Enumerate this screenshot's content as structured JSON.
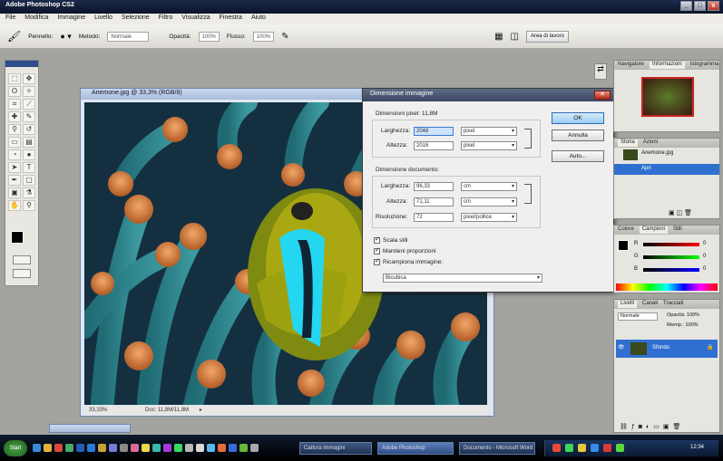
{
  "app": {
    "title": "Adobe Photoshop CS2",
    "window_buttons": [
      "_",
      "□",
      "x"
    ]
  },
  "menubar": {
    "items": [
      "File",
      "Modifica",
      "Immagine",
      "Livello",
      "Selezione",
      "Filtro",
      "Visualizza",
      "Finestra",
      "Aiuto"
    ]
  },
  "options_bar": {
    "tool_icon": "brush-icon",
    "brush_label": "Pennello:",
    "mode_label": "Metodo:",
    "mode_value": "Normale",
    "opacity_label": "Opacità:",
    "opacity_value": "100%",
    "flow_label": "Flusso:",
    "flow_value": "100%",
    "workspace_button": "Area di lavoro"
  },
  "document": {
    "title": "Anemone.jpg @ 33,3% (RGB/8)",
    "zoom": "33,33%",
    "status": "Doc: 11,8M/11,8M"
  },
  "dialog": {
    "title": "Dimensione immagine",
    "pixel_dims_label": "Dimensioni pixel: 11,8M",
    "width_label": "Larghezza:",
    "width_value": "2048",
    "width_unit": "pixel",
    "height_label": "Altezza:",
    "height_value": "2016",
    "height_unit": "pixel",
    "doc_size_label": "Dimensione documento:",
    "doc_width_label": "Larghezza:",
    "doc_width_value": "96,33",
    "doc_width_unit": "cm",
    "doc_height_label": "Altezza:",
    "doc_height_value": "71,11",
    "doc_height_unit": "cm",
    "resolution_label": "Risoluzione:",
    "resolution_value": "72",
    "resolution_unit": "pixel/pollice",
    "scale_styles": "Scala stili",
    "constrain": "Mantieni proporzioni",
    "resample": "Ricampiona immagine:",
    "resample_method": "Bicubica",
    "ok": "OK",
    "cancel": "Annulla",
    "auto": "Auto..."
  },
  "panels": {
    "navigator_tabs": [
      "Navigatore",
      "Informazioni",
      "Istogramma"
    ],
    "history_tabs": [
      "Storia",
      "Azioni"
    ],
    "history_items": [
      "Anemone.jpg",
      "Apri"
    ],
    "color_tabs": [
      "Colore",
      "Campioni",
      "Stili"
    ],
    "color_channels": [
      "R",
      "G",
      "B"
    ],
    "color_values": [
      "0",
      "0",
      "0"
    ],
    "layers_tabs": [
      "Livelli",
      "Canali",
      "Tracciati"
    ],
    "layer_mode": "Normale",
    "layer_opacity": "Opacità: 100%",
    "layer_fill": "Riemp.: 100%",
    "layer_name": "Sfondo"
  },
  "taskbar": {
    "start": "Start",
    "tasks": [
      "Cattura immagini",
      "Adobe Photoshop",
      "Documento - Microsoft Word"
    ],
    "clock": "12:34"
  },
  "colors": {
    "accent": "#2c4d89",
    "dialog_title": "#3a4662",
    "selected_layer": "#2f6fd0",
    "workspace": "#a3a39f"
  }
}
